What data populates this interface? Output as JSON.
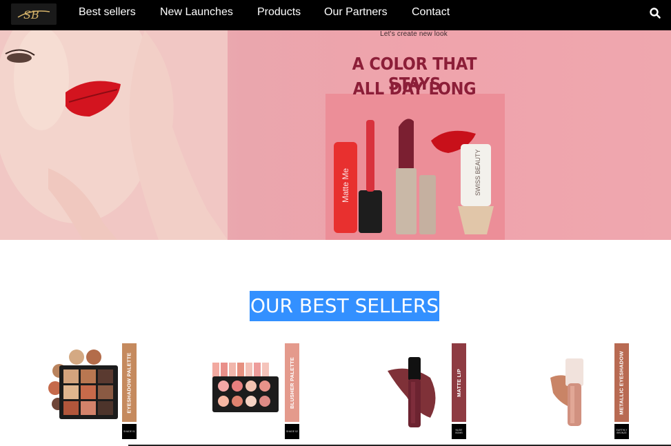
{
  "nav": {
    "logo_text": "SB",
    "links": [
      "Best sellers",
      "New Launches",
      "Products",
      "Our Partners",
      "Contact"
    ],
    "search_icon": "search-icon"
  },
  "hero": {
    "small_text": "Let's create new look",
    "headline_1": "A COLOR THAT STAYS",
    "headline_2": "ALL DAY LONG",
    "lipgloss_label": "Matte Me",
    "lipstick_brand": "SWISS BEAUTY"
  },
  "section": {
    "title": "OUR BEST SELLERS"
  },
  "products": [
    {
      "tag": "EYESHADOW PALETTE",
      "shade": "SHADE 01",
      "tag_color": "#c58a5e"
    },
    {
      "tag": "BLUSHER PALETTE",
      "shade": "SHADE 02",
      "tag_color": "#e49a8c"
    },
    {
      "tag": "MATTE LIP",
      "shade": "NUDE BOMB",
      "tag_color": "#8e3b42"
    },
    {
      "tag": "METALLIC EYESHADOW",
      "shade": "EARTHLY BRONZE",
      "tag_color": "#b86a52"
    }
  ],
  "colors": {
    "nav_bg": "#000000",
    "title_highlight": "#3390ff",
    "hero_bg": "#eaa6ad"
  }
}
